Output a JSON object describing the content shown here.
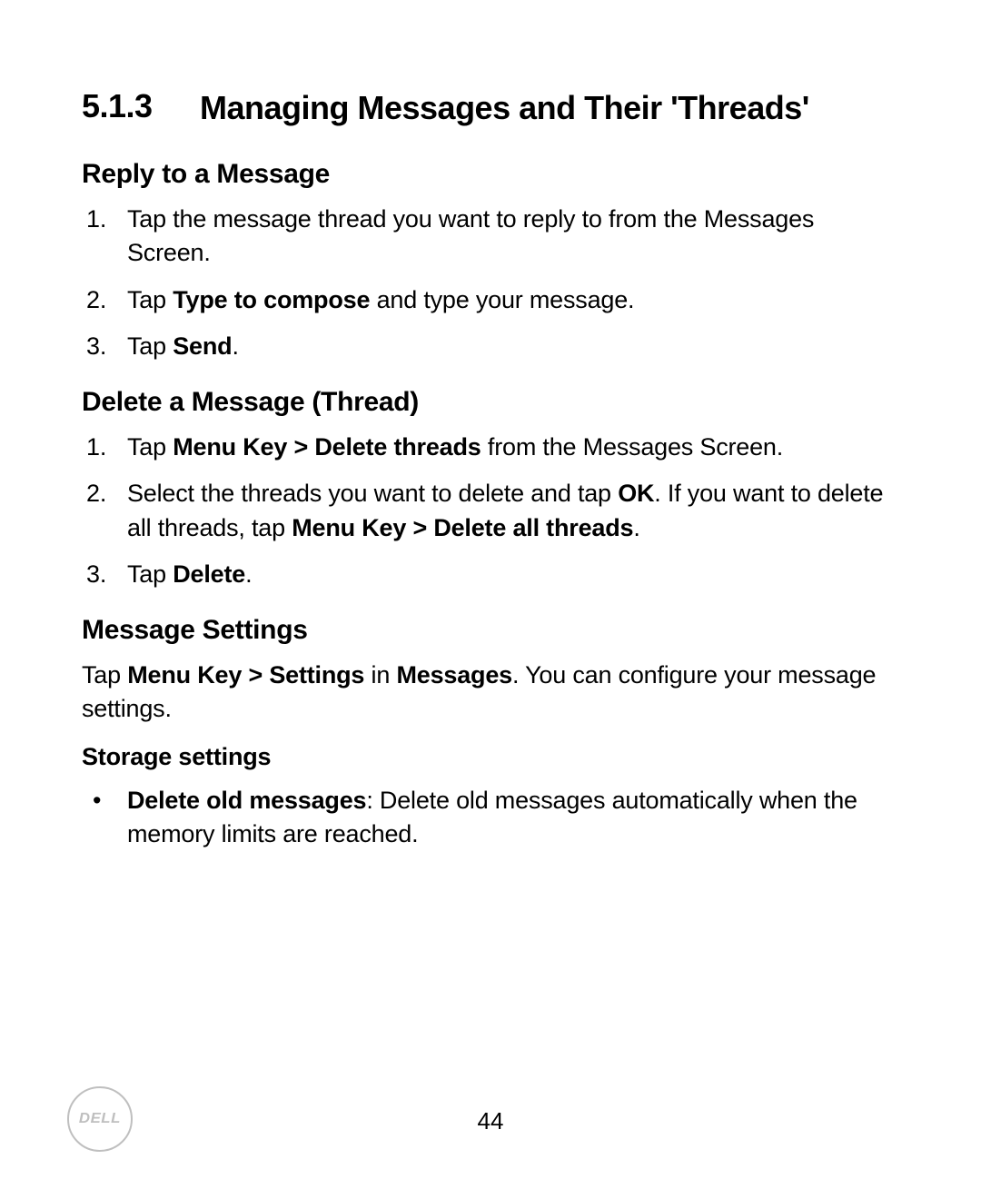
{
  "section": {
    "number": "5.1.3",
    "title": "Managing Messages and Their 'Threads'"
  },
  "reply": {
    "heading": "Reply to a Message",
    "steps": [
      {
        "html": "Tap the message thread you want to reply to from the Messages Screen."
      },
      {
        "html": "Tap <strong>Type to compose</strong> and type your message."
      },
      {
        "html": "Tap <strong>Send</strong>."
      }
    ]
  },
  "deleteThread": {
    "heading": "Delete a Message (Thread)",
    "steps": [
      {
        "html": "Tap <strong>Menu Key &gt; Delete threads</strong> from the Messages Screen."
      },
      {
        "html": "Select the threads you want to delete and tap <strong>OK</strong>. If you want to delete all threads, tap <strong>Menu Key &gt; Delete all threads</strong>."
      },
      {
        "html": "Tap <strong>Delete</strong>."
      }
    ]
  },
  "settings": {
    "heading": "Message Settings",
    "intro": {
      "html": "Tap <strong>Menu Key &gt; Settings</strong> in <strong>Messages</strong>. You can configure your message settings."
    },
    "storage": {
      "heading": "Storage settings",
      "bullets": [
        {
          "html": "<strong>Delete old messages</strong>: Delete old messages automatically when the memory limits are reached."
        }
      ]
    }
  },
  "pageNumber": "44",
  "logoText": "DELL"
}
